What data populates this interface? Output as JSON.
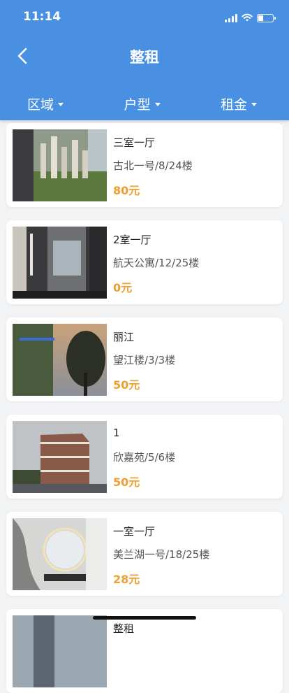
{
  "status": {
    "time": "11:14"
  },
  "nav": {
    "title": "整租"
  },
  "filters": [
    {
      "label": "区域"
    },
    {
      "label": "户型"
    },
    {
      "label": "租金"
    }
  ],
  "listings": [
    {
      "name": "三室一厅",
      "address": "古北一号/8/24楼",
      "price": "80元"
    },
    {
      "name": "2室一厅",
      "address": "航天公寓/12/25楼",
      "price": "0元"
    },
    {
      "name": "丽江",
      "address": "望江楼/3/3楼",
      "price": "50元"
    },
    {
      "name": "1",
      "address": "欣嘉苑/5/6楼",
      "price": "50元"
    },
    {
      "name": "一室一厅",
      "address": "美兰湖一号/18/25楼",
      "price": "28元"
    },
    {
      "name": "整租"
    }
  ],
  "icons": {
    "back": "chevron-left-icon",
    "signal": "signal-icon",
    "wifi": "wifi-icon",
    "battery": "battery-icon"
  },
  "colors": {
    "header": "#4a90e2",
    "price": "#f0a030"
  }
}
